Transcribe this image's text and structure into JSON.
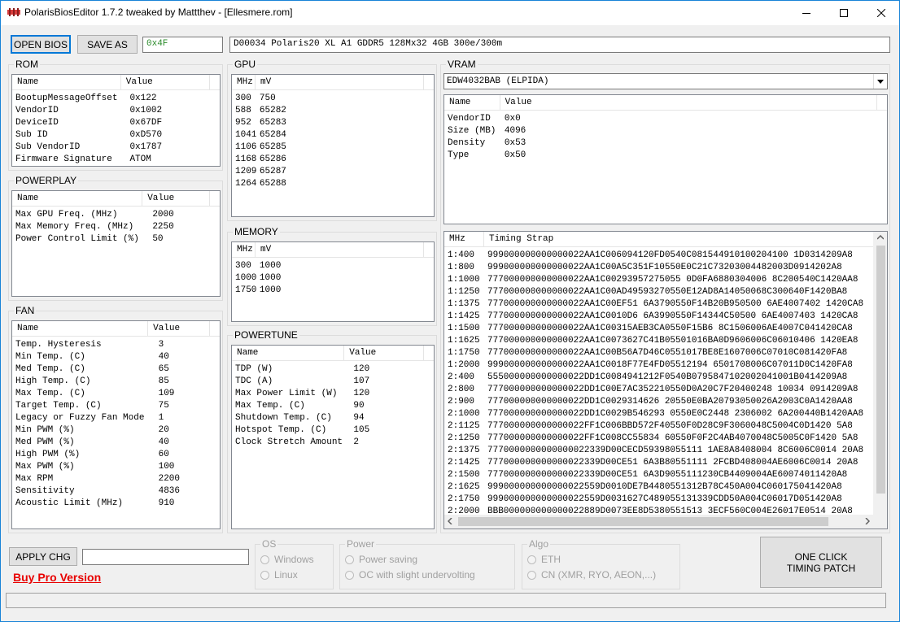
{
  "window": {
    "title": "PolarisBiosEditor 1.7.2 tweaked by Mattthev  - [Ellesmere.rom]",
    "controls": [
      "minimize-icon",
      "maximize-icon",
      "close-icon"
    ]
  },
  "toolbar": {
    "open_label": "OPEN BIOS",
    "save_label": "SAVE AS",
    "checksum_value": "0x4F",
    "bios_description": "D00034 Polaris20 XL A1 GDDR5 128Mx32 4GB 300e/300m"
  },
  "rom": {
    "title": "ROM",
    "headers": [
      "Name",
      "Value"
    ],
    "rows": [
      [
        "BootupMessageOffset",
        "0x122"
      ],
      [
        "VendorID",
        "0x1002"
      ],
      [
        "DeviceID",
        "0x67DF"
      ],
      [
        "Sub ID",
        "0xD570"
      ],
      [
        "Sub VendorID",
        "0x1787"
      ],
      [
        "Firmware Signature",
        "ATOM"
      ]
    ]
  },
  "powerplay": {
    "title": "POWERPLAY",
    "headers": [
      "Name",
      "Value"
    ],
    "rows": [
      [
        "Max GPU Freq. (MHz)",
        "2000"
      ],
      [
        "Max Memory Freq. (MHz)",
        "2250"
      ],
      [
        "Power Control Limit (%)",
        "50"
      ]
    ]
  },
  "fan": {
    "title": "FAN",
    "headers": [
      "Name",
      "Value"
    ],
    "rows": [
      [
        "Temp. Hysteresis",
        "3"
      ],
      [
        "Min Temp. (C)",
        "40"
      ],
      [
        "Med Temp. (C)",
        "65"
      ],
      [
        "High Temp. (C)",
        "85"
      ],
      [
        "Max Temp. (C)",
        "109"
      ],
      [
        "Target Temp. (C)",
        "75"
      ],
      [
        "Legacy or Fuzzy Fan Mode",
        "1"
      ],
      [
        "Min PWM (%)",
        "20"
      ],
      [
        "Med PWM (%)",
        "40"
      ],
      [
        "High PWM (%)",
        "60"
      ],
      [
        "Max PWM (%)",
        "100"
      ],
      [
        "Max RPM",
        "2200"
      ],
      [
        "Sensitivity",
        "4836"
      ],
      [
        "Acoustic Limit (MHz)",
        "910"
      ]
    ]
  },
  "gpu": {
    "title": "GPU",
    "headers": [
      "MHz",
      "mV"
    ],
    "rows": [
      [
        "300",
        "750"
      ],
      [
        "588",
        "65282"
      ],
      [
        "952",
        "65283"
      ],
      [
        "1041",
        "65284"
      ],
      [
        "1106",
        "65285"
      ],
      [
        "1168",
        "65286"
      ],
      [
        "1209",
        "65287"
      ],
      [
        "1264",
        "65288"
      ]
    ]
  },
  "memory": {
    "title": "MEMORY",
    "headers": [
      "MHz",
      "mV"
    ],
    "rows": [
      [
        "300",
        "1000"
      ],
      [
        "1000",
        "1000"
      ],
      [
        "1750",
        "1000"
      ]
    ]
  },
  "powertune": {
    "title": "POWERTUNE",
    "headers": [
      "Name",
      "Value"
    ],
    "rows": [
      [
        "TDP (W)",
        "120"
      ],
      [
        "TDC (A)",
        "107"
      ],
      [
        "Max Power Limit (W)",
        "120"
      ],
      [
        "Max Temp. (C)",
        "90"
      ],
      [
        "Shutdown Temp. (C)",
        "94"
      ],
      [
        "Hotspot Temp. (C)",
        "105"
      ],
      [
        "Clock Stretch Amount",
        "2"
      ]
    ]
  },
  "vram": {
    "title": "VRAM",
    "selected_chip": "EDW4032BAB (ELPIDA)",
    "headers": [
      "Name",
      "Value"
    ],
    "rows": [
      [
        "VendorID",
        "0x0"
      ],
      [
        "Size (MB)",
        "4096"
      ],
      [
        "Density",
        "0x53"
      ],
      [
        "Type",
        "0x50"
      ]
    ]
  },
  "timings": {
    "headers": [
      "MHz",
      "Timing Strap"
    ],
    "rows": [
      [
        "1:400",
        "999000000000000022AA1C006094120FD0540C081544910100204100 1D0314209A8"
      ],
      [
        "1:800",
        "999000000000000022AA1C00A5C351F10550E0C21C73203004482003D0914202A8"
      ],
      [
        "1:1000",
        "777000000000000022AA1C00293957275055 0D0FA6880304006 8C200540C1420AA8"
      ],
      [
        "1:1250",
        "777000000000000022AA1C00AD49593270550E12AD8A14050068C300640F1420BA8"
      ],
      [
        "1:1375",
        "777000000000000022AA1C00EF51 6A3790550F14B20B950500 6AE4007402 1420CA8"
      ],
      [
        "1:1425",
        "777000000000000022AA1C0010D6 6A3990550F14344C50500 6AE4007403 1420CA8"
      ],
      [
        "1:1500",
        "777000000000000022AA1C00315AEB3CA0550F15B6 8C1506006AE4007C041420CA8"
      ],
      [
        "1:1625",
        "777000000000000022AA1C0073627C41B05501016BA0D9606006C06010406 1420EA8"
      ],
      [
        "1:1750",
        "777000000000000022AA1C00B56A7D46C0551017BE8E1607006C07010C081420FA8"
      ],
      [
        "1:2000",
        "999000000000000022AA1C0018F77E4FD05512194 6501708006C07011D0C1420FA8"
      ],
      [
        "2:400",
        "555000000000000022DD1C0084941212F0540B0795847102002041001B0414209A8"
      ],
      [
        "2:800",
        "777000000000000022DD1C00E7AC352210550D0A20C7F20400248 10034 0914209A8"
      ],
      [
        "2:900",
        "777000000000000022DD1C0029314626 20550E0BA20793050026A2003C0A1420AA8"
      ],
      [
        "2:1000",
        "777000000000000022DD1C0029B546293 0550E0C2448 2306002 6A200440B1420AA8"
      ],
      [
        "2:1125",
        "777000000000000022FF1C006BBD572F40550F0D28C9F3060048C5004C0D1420 5A8"
      ],
      [
        "2:1250",
        "777000000000000022FF1C008CC55834 60550F0F2C4AB4070048C5005C0F1420 5A8"
      ],
      [
        "2:1375",
        "7770000000000000022339D00CECD59398055111 1AE8A8408004 8C6006C0014 20A8"
      ],
      [
        "2:1425",
        "777000000000000022339D00CE51 6A3B80551111 2FCBD408004AE6006C0014 20A8"
      ],
      [
        "2:1500",
        "777000000000000022339D00CE51 6A3D9055111230CB4409004AE60074011420A8"
      ],
      [
        "2:1625",
        "999000000000000022559D0010DE7B4480551312B78C450A004C060175041420A8"
      ],
      [
        "2:1750",
        "999000000000000022559D0031627C489055131339CDD50A004C06017D051420A8"
      ],
      [
        "2:2000",
        "BBB000000000000022889D0073EE8D5380551513 3ECF560C004E26017E0514 20A8"
      ]
    ]
  },
  "bottom": {
    "apply_label": "APPLY CHG",
    "apply_input_value": "",
    "buy_label": "Buy Pro Version",
    "os_title": "OS",
    "os_options": [
      "Windows",
      "Linux"
    ],
    "power_title": "Power",
    "power_options": [
      "Power saving",
      "OC with slight undervolting"
    ],
    "algo_title": "Algo",
    "algo_options": [
      "ETH",
      "CN (XMR, RYO, AEON,...)"
    ],
    "timing_patch_label": "ONE CLICK TIMING PATCH",
    "status_text": ""
  }
}
